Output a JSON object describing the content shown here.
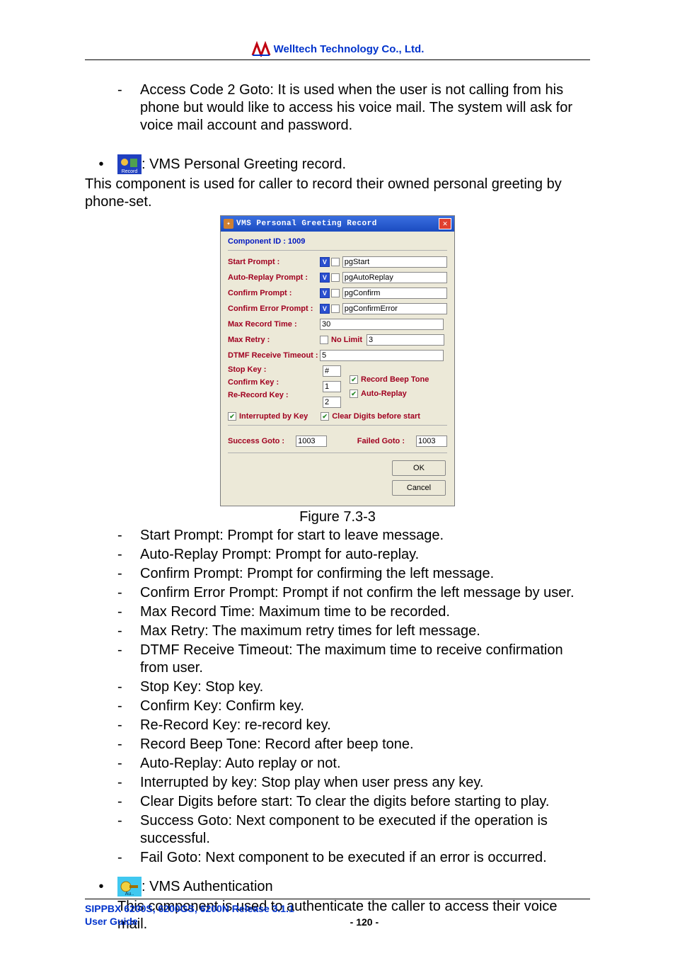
{
  "header": {
    "company": "Welltech Technology Co., Ltd."
  },
  "intro_item": "Access Code 2 Goto: It is used when the user is not calling from his phone but would like to access his voice mail. The system will ask for voice mail account and password.",
  "section1": {
    "title": ": VMS Personal Greeting record.",
    "desc": "This component is used for caller to record their owned personal greeting by phone-set."
  },
  "dialog": {
    "title": "VMS Personal Greeting Record",
    "component_id": "Component ID : 1009",
    "labels": {
      "start_prompt": "Start Prompt :",
      "auto_replay_prompt": "Auto-Replay Prompt :",
      "confirm_prompt": "Confirm Prompt :",
      "confirm_error_prompt": "Confirm Error Prompt :",
      "max_record_time": "Max Record Time :",
      "max_retry": "Max Retry :",
      "no_limit": "No Limit",
      "dtmf_timeout": "DTMF Receive Timeout :",
      "stop_key": "Stop Key :",
      "confirm_key": "Confirm Key :",
      "rerecord_key": "Re-Record Key :",
      "record_beep": "Record Beep Tone",
      "auto_replay": "Auto-Replay",
      "interrupted": "Interrupted by Key",
      "clear_digits": "Clear Digits before start",
      "success_goto": "Success Goto :",
      "failed_goto": "Failed Goto :"
    },
    "values": {
      "start_prompt": "pgStart",
      "auto_replay_prompt": "pgAutoReplay",
      "confirm_prompt": "pgConfirm",
      "confirm_error_prompt": "pgConfirmError",
      "max_record_time": "30",
      "max_retry": "3",
      "dtmf_timeout": "5",
      "stop_key": "#",
      "confirm_key": "1",
      "rerecord_key": "2",
      "success_goto": "1003",
      "failed_goto": "1003"
    },
    "buttons": {
      "ok": "OK",
      "cancel": "Cancel"
    }
  },
  "figure_caption": "Figure 7.3-3",
  "list": [
    "Start Prompt: Prompt for start to leave message.",
    "Auto-Replay Prompt: Prompt for auto-replay.",
    "Confirm Prompt: Prompt for confirming the left message.",
    "Confirm Error Prompt: Prompt if not confirm the left message by user.",
    "Max Record Time: Maximum time to be recorded.",
    "Max Retry: The maximum retry times for left message.",
    "DTMF Receive Timeout: The maximum time to receive confirmation from user.",
    "Stop Key: Stop key.",
    "Confirm Key: Confirm key.",
    "Re-Record Key: re-record key.",
    "Record Beep Tone: Record after beep tone.",
    "Auto-Replay: Auto replay or not.",
    "Interrupted by key: Stop play when user press any key.",
    "Clear Digits before start: To clear the digits before starting to play.",
    "Success Goto: Next component to be executed if the operation is successful.",
    "Fail Goto: Next component to be executed if an error is occurred."
  ],
  "section2": {
    "title": ": VMS Authentication",
    "desc": "This component is used to authenticate the caller to access their voice mail."
  },
  "footer": {
    "line1": "SIPPBX 6200S, 6200GS, 6200N Release 3.1.1",
    "line2": "User Guide",
    "page": "- 120 -"
  }
}
